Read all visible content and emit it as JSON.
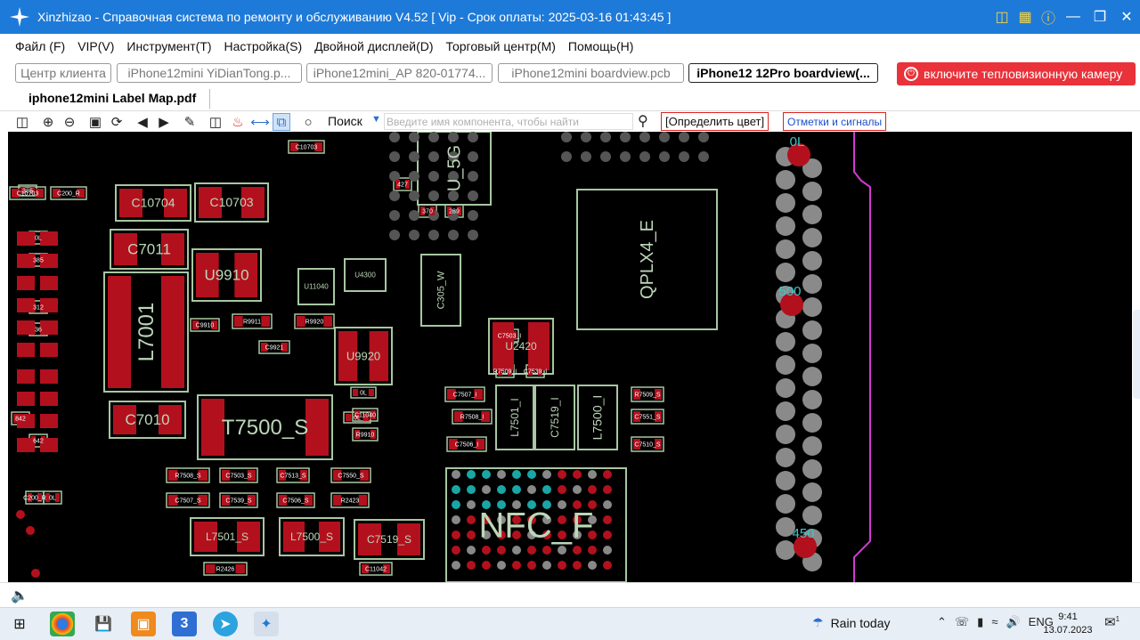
{
  "window": {
    "title": "Xinzhizao - Справочная система по ремонту и обслуживанию V4.52 [ Vip - Срок оплаты: 2025-03-16 01:43:45 ]"
  },
  "menu": [
    "Файл (F)",
    "VIP(V)",
    "Инструмент(T)",
    "Настройка(S)",
    "Двойной дисплей(D)",
    "Торговый центр(M)",
    "Помощь(H)"
  ],
  "tabs": [
    "Центр клиента",
    "iPhone12mini YiDianTong.p...",
    "iPhone12mini_AP 820-01774...",
    "iPhone12mini boardview.pcb",
    "iPhone12 12Pro boardview(..."
  ],
  "thermal_button": "включите тепловизионную камеру",
  "doc_tab": "iphone12mini Label Map.pdf",
  "toolbar": {
    "search_label": "Поиск",
    "search_placeholder": "Введите имя компонента, чтобы найти",
    "color_button": "[Определить цвет]",
    "marks_button": "Отметки и сигналы"
  },
  "board": {
    "labels": [
      "C10704",
      "C10703",
      "C7011",
      "U9910",
      "L7001",
      "C7010",
      "T7500_S",
      "U9920",
      "U2420",
      "L7501_I",
      "C7519_I",
      "L7500_I",
      "L7501_S",
      "L7500_S",
      "C7519_S",
      "NFC_F",
      "QPLX4_E",
      "U_5G",
      "U11040",
      "U4300",
      "C305_W"
    ],
    "small_labels": [
      "C10703",
      "C200_R",
      "0L",
      "385",
      "312",
      "36",
      "842",
      "642",
      "427",
      "370",
      "289",
      "C7503_I",
      "R7509_I",
      "C7539_I",
      "C7507_I",
      "R7508_I",
      "C7506_I",
      "R7509_S",
      "C7551_S",
      "C7510_S",
      "R7508_S",
      "C7503_S",
      "C7513_S",
      "C7550_S",
      "C7507_S",
      "C7539_S",
      "C7506_S",
      "R2423",
      "R2426",
      "C11042",
      "C11040",
      "R9910",
      "R9911",
      "R9920",
      "C9910",
      "C9921",
      "0L",
      "0L"
    ],
    "pad_values": [
      "500",
      "450",
      "0L"
    ]
  },
  "taskbar": {
    "weather": "Rain today",
    "language": "ENG",
    "time": "9:41",
    "date": "13.07.2023",
    "notification_count": "1"
  }
}
